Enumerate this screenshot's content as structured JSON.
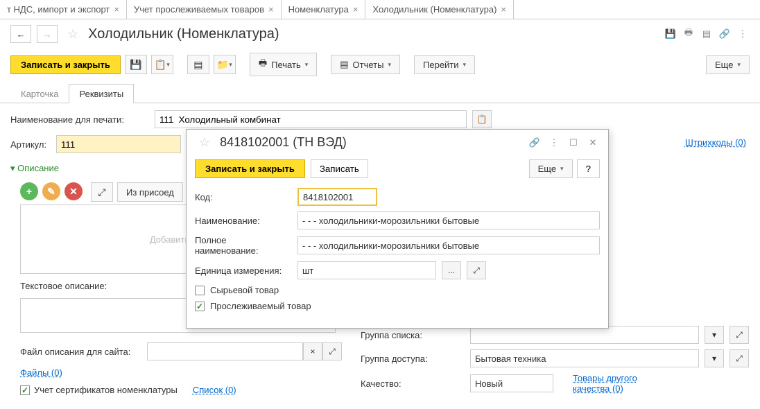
{
  "tabs": [
    {
      "label": "т НДС, импорт и экспорт"
    },
    {
      "label": "Учет прослеживаемых товаров"
    },
    {
      "label": "Номенклатура"
    },
    {
      "label": "Холодильник (Номенклатура)"
    }
  ],
  "page_title": "Холодильник (Номенклатура)",
  "toolbar": {
    "save_close": "Записать и закрыть",
    "print": "Печать",
    "reports": "Отчеты",
    "goto": "Перейти",
    "more": "Еще"
  },
  "sub_tabs": {
    "card": "Карточка",
    "props": "Реквизиты"
  },
  "form": {
    "print_name_label": "Наименование для печати:",
    "print_name_value": "111  Холодильный комбинат",
    "article_label": "Артикул:",
    "article_value": "111",
    "description_section": "Описание",
    "from_attached": "Из присоед",
    "image_placeholder": "Добавить изо",
    "text_desc_label": "Текстовое описание:",
    "site_desc_label": "Файл описания для сайта:",
    "files_link": "Файлы (0)",
    "cert_checkbox": "Учет сертификатов номенклатуры",
    "list_link": "Список (0)",
    "barcodes_link": "Штрихкоды (0)"
  },
  "right_fields": {
    "list_group_label": "Группа списка:",
    "list_group_value": "",
    "access_group_label": "Группа доступа:",
    "access_group_value": "Бытовая техника",
    "quality_label": "Качество:",
    "quality_value": "Новый",
    "other_quality_link": "Товары другого качества (0)"
  },
  "modal": {
    "title": "8418102001 (ТН ВЭД)",
    "save_close": "Записать и закрыть",
    "save": "Записать",
    "more": "Еще",
    "help": "?",
    "code_label": "Код:",
    "code_value": "8418102001",
    "name_label": "Наименование:",
    "name_value": "- - - холодильники-морозильники бытовые",
    "full_name_label": "Полное наименование:",
    "full_name_value": "- - - холодильники-морозильники бытовые",
    "unit_label": "Единица измерения:",
    "unit_value": "шт",
    "raw_goods": "Сырьевой товар",
    "traceable": "Прослеживаемый товар"
  }
}
